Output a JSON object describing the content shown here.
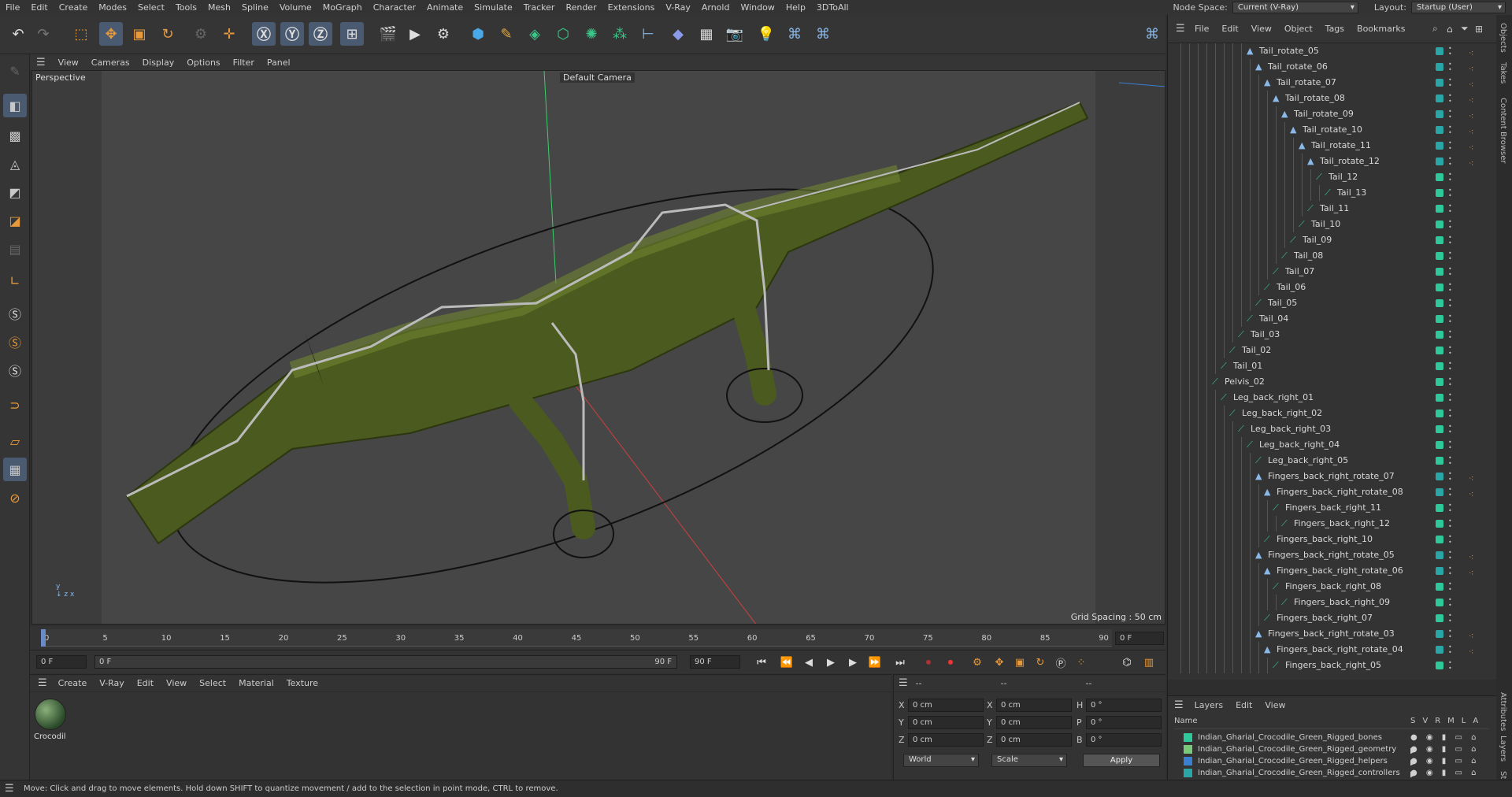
{
  "menu": {
    "items": [
      "File",
      "Edit",
      "Create",
      "Modes",
      "Select",
      "Tools",
      "Mesh",
      "Spline",
      "Volume",
      "MoGraph",
      "Character",
      "Animate",
      "Simulate",
      "Tracker",
      "Render",
      "Extensions",
      "V-Ray",
      "Arnold",
      "Window",
      "Help",
      "3DToAll"
    ],
    "node_space_label": "Node Space:",
    "node_space_value": "Current (V-Ray)",
    "layout_label": "Layout:",
    "layout_value": "Startup (User)"
  },
  "viewport_menu": [
    "View",
    "Cameras",
    "Display",
    "Options",
    "Filter",
    "Panel"
  ],
  "viewport": {
    "view_name": "Perspective",
    "camera": "Default Camera",
    "grid_spacing": "Grid Spacing : 50 cm"
  },
  "timeline": {
    "ticks": [
      "0",
      "5",
      "10",
      "15",
      "20",
      "25",
      "30",
      "35",
      "40",
      "45",
      "50",
      "55",
      "60",
      "65",
      "70",
      "75",
      "80",
      "85",
      "90"
    ],
    "current_frame": "0 F"
  },
  "transport": {
    "start": "0 F",
    "range_start": "0 F",
    "range_end": "90 F",
    "end": "90 F"
  },
  "material_menu": [
    "Create",
    "V-Ray",
    "Edit",
    "View",
    "Select",
    "Material",
    "Texture"
  ],
  "material": {
    "name": "Crocodil"
  },
  "attributes": {
    "header": [
      "--",
      "--",
      "--"
    ],
    "x_label": "X",
    "y_label": "Y",
    "z_label": "Z",
    "h_label": "H",
    "p_label": "P",
    "b_label": "B",
    "x": "0 cm",
    "y": "0 cm",
    "z": "0 cm",
    "sx": "0 cm",
    "sy": "0 cm",
    "sz": "0 cm",
    "h": "0 °",
    "p": "0 °",
    "b": "0 °",
    "coord": "World",
    "mode": "Scale",
    "apply": "Apply"
  },
  "objects_menu": [
    "File",
    "Edit",
    "View",
    "Object",
    "Tags",
    "Bookmarks"
  ],
  "objects": [
    {
      "name": "Tail_rotate_05",
      "indent": 8,
      "type": "null"
    },
    {
      "name": "Tail_rotate_06",
      "indent": 9,
      "type": "null"
    },
    {
      "name": "Tail_rotate_07",
      "indent": 10,
      "type": "null"
    },
    {
      "name": "Tail_rotate_08",
      "indent": 11,
      "type": "null"
    },
    {
      "name": "Tail_rotate_09",
      "indent": 12,
      "type": "null"
    },
    {
      "name": "Tail_rotate_10",
      "indent": 13,
      "type": "null"
    },
    {
      "name": "Tail_rotate_11",
      "indent": 14,
      "type": "null"
    },
    {
      "name": "Tail_rotate_12",
      "indent": 15,
      "type": "null"
    },
    {
      "name": "Tail_12",
      "indent": 16,
      "type": "bone"
    },
    {
      "name": "Tail_13",
      "indent": 17,
      "type": "bone"
    },
    {
      "name": "Tail_11",
      "indent": 15,
      "type": "bone"
    },
    {
      "name": "Tail_10",
      "indent": 14,
      "type": "bone"
    },
    {
      "name": "Tail_09",
      "indent": 13,
      "type": "bone"
    },
    {
      "name": "Tail_08",
      "indent": 12,
      "type": "bone"
    },
    {
      "name": "Tail_07",
      "indent": 11,
      "type": "bone"
    },
    {
      "name": "Tail_06",
      "indent": 10,
      "type": "bone"
    },
    {
      "name": "Tail_05",
      "indent": 9,
      "type": "bone"
    },
    {
      "name": "Tail_04",
      "indent": 8,
      "type": "bone"
    },
    {
      "name": "Tail_03",
      "indent": 7,
      "type": "bone"
    },
    {
      "name": "Tail_02",
      "indent": 6,
      "type": "bone"
    },
    {
      "name": "Tail_01",
      "indent": 5,
      "type": "bone"
    },
    {
      "name": "Pelvis_02",
      "indent": 4,
      "type": "bone"
    },
    {
      "name": "Leg_back_right_01",
      "indent": 5,
      "type": "bone"
    },
    {
      "name": "Leg_back_right_02",
      "indent": 6,
      "type": "bone"
    },
    {
      "name": "Leg_back_right_03",
      "indent": 7,
      "type": "bone"
    },
    {
      "name": "Leg_back_right_04",
      "indent": 8,
      "type": "bone"
    },
    {
      "name": "Leg_back_right_05",
      "indent": 9,
      "type": "bone"
    },
    {
      "name": "Fingers_back_right_rotate_07",
      "indent": 9,
      "type": "null"
    },
    {
      "name": "Fingers_back_right_rotate_08",
      "indent": 10,
      "type": "null"
    },
    {
      "name": "Fingers_back_right_11",
      "indent": 11,
      "type": "bone"
    },
    {
      "name": "Fingers_back_right_12",
      "indent": 12,
      "type": "bone"
    },
    {
      "name": "Fingers_back_right_10",
      "indent": 10,
      "type": "bone"
    },
    {
      "name": "Fingers_back_right_rotate_05",
      "indent": 9,
      "type": "null"
    },
    {
      "name": "Fingers_back_right_rotate_06",
      "indent": 10,
      "type": "null"
    },
    {
      "name": "Fingers_back_right_08",
      "indent": 11,
      "type": "bone"
    },
    {
      "name": "Fingers_back_right_09",
      "indent": 12,
      "type": "bone"
    },
    {
      "name": "Fingers_back_right_07",
      "indent": 10,
      "type": "bone"
    },
    {
      "name": "Fingers_back_right_rotate_03",
      "indent": 9,
      "type": "null"
    },
    {
      "name": "Fingers_back_right_rotate_04",
      "indent": 10,
      "type": "null"
    },
    {
      "name": "Fingers_back_right_05",
      "indent": 11,
      "type": "bone"
    }
  ],
  "layers_menu": [
    "Layers",
    "Edit",
    "View"
  ],
  "layers_header": {
    "name": "Name",
    "cols": [
      "S",
      "V",
      "R",
      "M",
      "L",
      "A"
    ]
  },
  "layers": [
    {
      "name": "Indian_Gharial_Crocodile_Green_Rigged_bones",
      "color": "#2fc89a"
    },
    {
      "name": "Indian_Gharial_Crocodile_Green_Rigged_geometry",
      "color": "#7ac87a"
    },
    {
      "name": "Indian_Gharial_Crocodile_Green_Rigged_helpers",
      "color": "#3a7fd0"
    },
    {
      "name": "Indian_Gharial_Crocodile_Green_Rigged_controllers",
      "color": "#2aa6a6"
    }
  ],
  "side_tabs": [
    "Objects",
    "Takes",
    "Content Browser",
    "Attributes",
    "Layers",
    "Struc"
  ],
  "status": "Move: Click and drag to move elements. Hold down SHIFT to quantize movement / add to the selection in point mode, CTRL to remove."
}
